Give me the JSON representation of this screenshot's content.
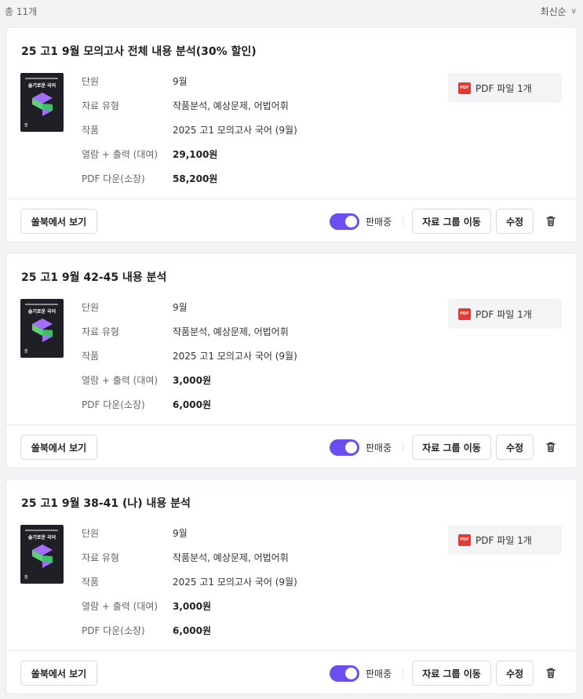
{
  "header": {
    "total_label": "총 11개",
    "sort_label": "최신순"
  },
  "cards": [
    {
      "title": "25 고1 9월 모의고사 전체 내용 분석(30% 할인)",
      "cover_title": "슬기로운 국어",
      "fields": [
        {
          "label": "단원",
          "value": "9월"
        },
        {
          "label": "자료 유형",
          "value": "작품분석, 예상문제, 어법어휘"
        },
        {
          "label": "작품",
          "value": "2025 고1 모의고사 국어 (9월)"
        },
        {
          "label": "열람 + 출력 (대여)",
          "value": "29,100원"
        },
        {
          "label": "PDF 다운(소장)",
          "value": "58,200원"
        }
      ],
      "pdf_badge": "PDF",
      "pdf_label": "PDF 파일 1개",
      "view_button": "쏠북에서 보기",
      "toggle_label": "판매중",
      "move_button": "자료 그룹 이동",
      "edit_button": "수정"
    },
    {
      "title": "25 고1 9월 42-45 내용 분석",
      "cover_title": "슬기로운 국어",
      "fields": [
        {
          "label": "단원",
          "value": "9월"
        },
        {
          "label": "자료 유형",
          "value": "작품분석, 예상문제, 어법어휘"
        },
        {
          "label": "작품",
          "value": "2025 고1 모의고사 국어 (9월)"
        },
        {
          "label": "열람 + 출력 (대여)",
          "value": "3,000원"
        },
        {
          "label": "PDF 다운(소장)",
          "value": "6,000원"
        }
      ],
      "pdf_badge": "PDF",
      "pdf_label": "PDF 파일 1개",
      "view_button": "쏠북에서 보기",
      "toggle_label": "판매중",
      "move_button": "자료 그룹 이동",
      "edit_button": "수정"
    },
    {
      "title": "25 고1 9월 38-41 (나) 내용 분석",
      "cover_title": "슬기로운 국어",
      "fields": [
        {
          "label": "단원",
          "value": "9월"
        },
        {
          "label": "자료 유형",
          "value": "작품분석, 예상문제, 어법어휘"
        },
        {
          "label": "작품",
          "value": "2025 고1 모의고사 국어 (9월)"
        },
        {
          "label": "열람 + 출력 (대여)",
          "value": "3,000원"
        },
        {
          "label": "PDF 다운(소장)",
          "value": "6,000원"
        }
      ],
      "pdf_badge": "PDF",
      "pdf_label": "PDF 파일 1개",
      "view_button": "쏠북에서 보기",
      "toggle_label": "판매중",
      "move_button": "자료 그룹 이동",
      "edit_button": "수정"
    }
  ],
  "colors": {
    "accent": "#6b4ef0",
    "pdf_red": "#e53935",
    "cover_bg": "#1e2025"
  },
  "icons": {
    "sort": "chevron-down-icon",
    "delete": "trash-icon",
    "file": "pdf-file-icon"
  }
}
